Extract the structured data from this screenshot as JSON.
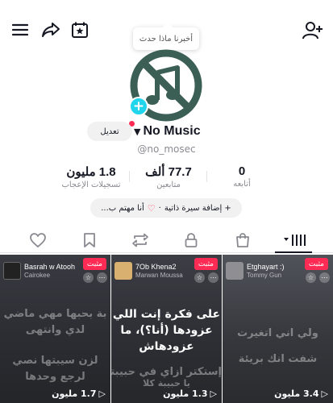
{
  "header": {
    "tooltip_text": "أخبرنا ماذا حدث",
    "icons": [
      "menu-icon",
      "share-icon",
      "calendar-star-icon",
      "add-user-icon"
    ]
  },
  "profile": {
    "display_name": "No Music",
    "username": "@no_mosec",
    "edit_label": "تعديل",
    "avatar_icon": "no-music-icon",
    "bio_button_prefix": "+ إضافة سيرة ذاتية",
    "bio_button_suffix": "أنا مهتم ب...",
    "bio_separator": "·"
  },
  "stats": {
    "likes": {
      "value": "1.8 مليون",
      "label": "تسجيلات الإعجاب"
    },
    "followers": {
      "value": "77.7 ألف",
      "label": "متابعين"
    },
    "following": {
      "value": "0",
      "label": "أتابعه"
    }
  },
  "tabs": [
    "videos-grid-icon",
    "shop-bag-icon",
    "lock-icon",
    "repost-icon",
    "bookmark-icon",
    "heart-icon"
  ],
  "videos": [
    {
      "pinned_label": "مثبت",
      "song_title": ":)",
      "song_title_full": "Etghayart",
      "song_artist": "Tommy Gun",
      "lyrics_top": "",
      "lyrics_main": [
        "ولي اني اتغيرت",
        "شفت انك بريئة"
      ],
      "lyrics_bottom": "",
      "views": "3.4 مليون"
    },
    {
      "pinned_label": "مثبت",
      "song_title": "7Ob Khena2",
      "song_artist": "Marwan Moussa",
      "lyrics_top": "",
      "lyrics_main": [
        "على فكرة إنت اللي",
        "عزودها (أنا؟)، ما",
        "عزودهاش"
      ],
      "lyrics_bottom": [
        "إستكتر ازاي في حبيبتك",
        "يا حبيبة كلا"
      ],
      "views": "1.3 مليون"
    },
    {
      "pinned_label": "مثبت",
      "song_title": "Basrah w Atooh",
      "song_artist": "Cairokee",
      "lyrics_top": [
        "بة بحبها مهي ماضي",
        "لدي وانتهى"
      ],
      "lyrics_main": [],
      "lyrics_bottom": [
        "لزن سيبتها نصي",
        "لرجع وحدها"
      ],
      "views": "1.7 مليون"
    }
  ],
  "colors": {
    "accent": "#fe2c55",
    "cyan": "#20d5ec",
    "avatar": "#3b5e55",
    "text": "#161823",
    "muted": "#8a8b91"
  }
}
